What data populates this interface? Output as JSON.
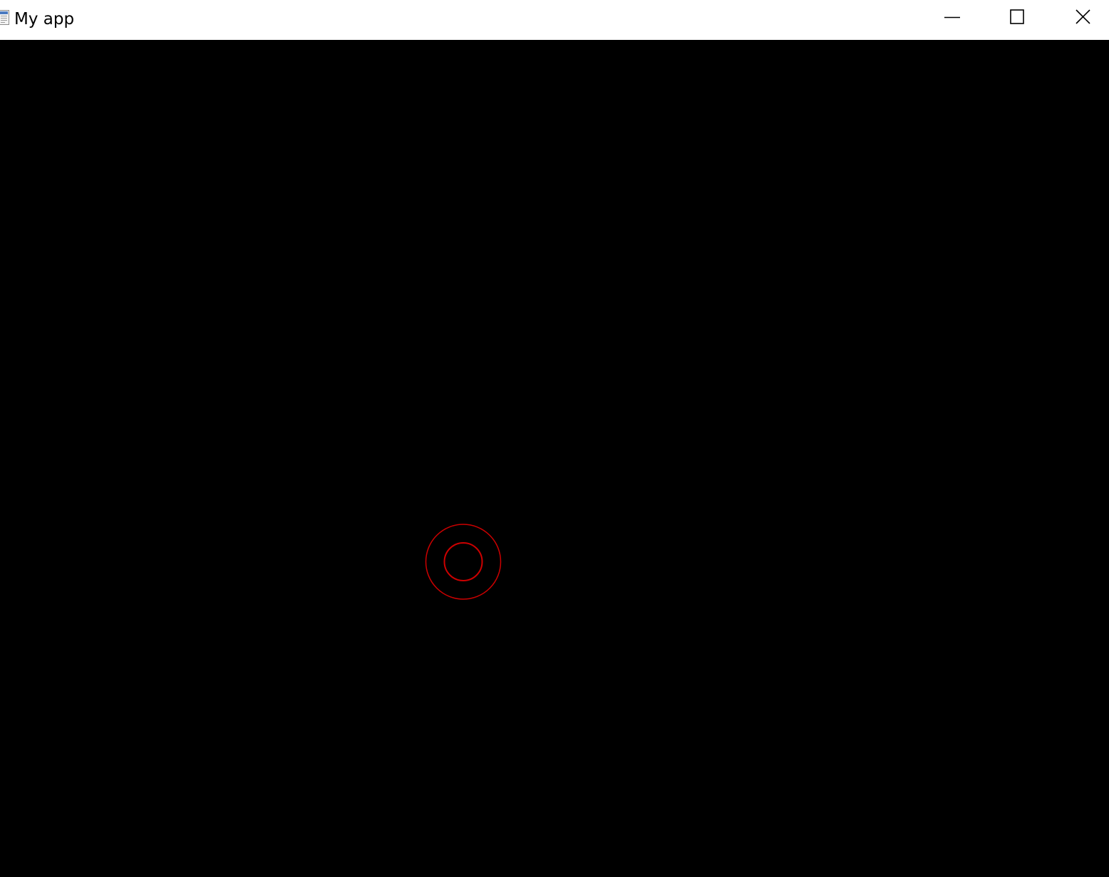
{
  "window": {
    "title": "My app",
    "icon": "app-window-icon",
    "controls": [
      {
        "name": "minimize-button",
        "icon": "minimize-icon"
      },
      {
        "name": "maximize-button",
        "icon": "maximize-icon"
      },
      {
        "name": "close-button",
        "icon": "close-icon"
      }
    ]
  },
  "canvas": {
    "background": "#000000",
    "shape_color": "#cc0000",
    "shapes": [
      "outer-ring",
      "inner-ring"
    ]
  }
}
